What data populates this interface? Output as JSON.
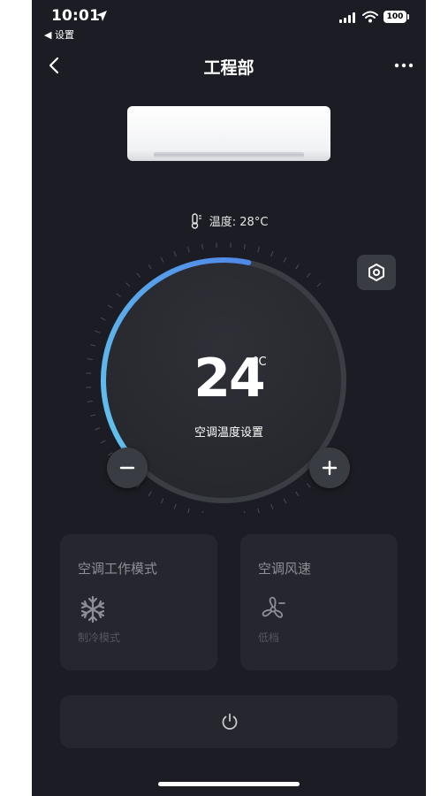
{
  "status_bar": {
    "time": "10:01",
    "back_app": "◀ 设置",
    "battery": "100"
  },
  "nav": {
    "title": "工程部"
  },
  "readout": {
    "label": "温度",
    "separator": ":",
    "value": "28°C"
  },
  "dial": {
    "value": "24",
    "unit": "°C",
    "caption": "空调温度设置",
    "min_label": "−",
    "max_label": "+"
  },
  "mode_card": {
    "title": "空调工作模式",
    "icon": "snowflake-icon",
    "value": "制冷模式"
  },
  "fan_card": {
    "title": "空调风速",
    "icon": "fan-icon",
    "value": "低档"
  },
  "power": {
    "icon": "power-icon"
  },
  "colors": {
    "background": "#1c1d24",
    "card": "#25262e",
    "accent": "#5aa9f0"
  }
}
